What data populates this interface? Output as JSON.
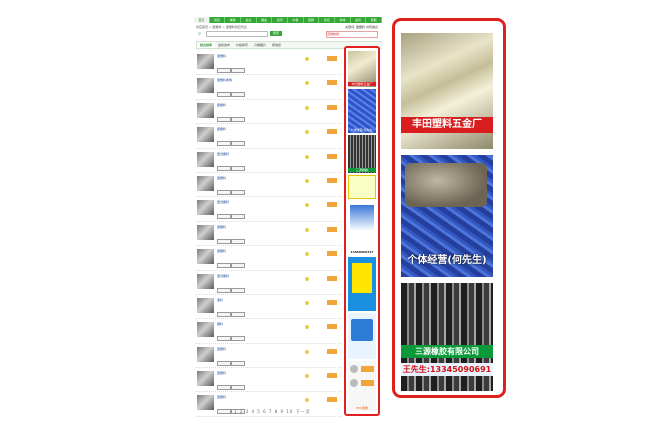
{
  "nav": {
    "items": [
      "首页",
      "供应",
      "求购",
      "企业",
      "展会",
      "资讯",
      "价格",
      "招聘",
      "论坛",
      "商城",
      "会员",
      "帮助"
    ]
  },
  "breadcrumb": "供应首页 > 废塑料 > 废塑料供应列表",
  "keyword_label": "关键词: 废塑料 共有信息",
  "search": {
    "placeholder": "",
    "button": "搜索"
  },
  "phone_box": "咨询热线",
  "tabs": [
    "综合排序",
    "最新发布",
    "价格排序",
    "只看图片",
    "按地区"
  ],
  "listings": [
    {
      "title": "废塑料",
      "desc": ""
    },
    {
      "title": "废塑料收购",
      "desc": ""
    },
    {
      "title": "废塑料",
      "desc": ""
    },
    {
      "title": "废塑料",
      "desc": ""
    },
    {
      "title": "废旧塑料",
      "desc": ""
    },
    {
      "title": "废塑料",
      "desc": ""
    },
    {
      "title": "废旧塑料",
      "desc": ""
    },
    {
      "title": "废塑料",
      "desc": ""
    },
    {
      "title": "废塑料",
      "desc": ""
    },
    {
      "title": "废旧塑料",
      "desc": ""
    },
    {
      "title": "废料",
      "desc": ""
    },
    {
      "title": "塑料",
      "desc": ""
    },
    {
      "title": "废塑料",
      "desc": ""
    },
    {
      "title": "废塑料",
      "desc": ""
    },
    {
      "title": "废塑料",
      "desc": ""
    }
  ],
  "pager": "1 2 3 4 5 6 7 8 9 10 下一页",
  "mini_ads": [
    "丰田塑料五金厂",
    "个体经营(何先生)",
    "三源橡胶",
    "",
    "13858660317",
    "",
    "",
    "PVC回收"
  ],
  "zoom_ads": {
    "plastic_factory": "丰田塑料五金厂",
    "individual": "个体经营(何先生)",
    "rubber_company": "三源橡胶有限公司",
    "rubber_phone": "王先生:13345090691"
  },
  "colors": {
    "highlight": "#e01f1f",
    "brand_green": "#34a834"
  }
}
